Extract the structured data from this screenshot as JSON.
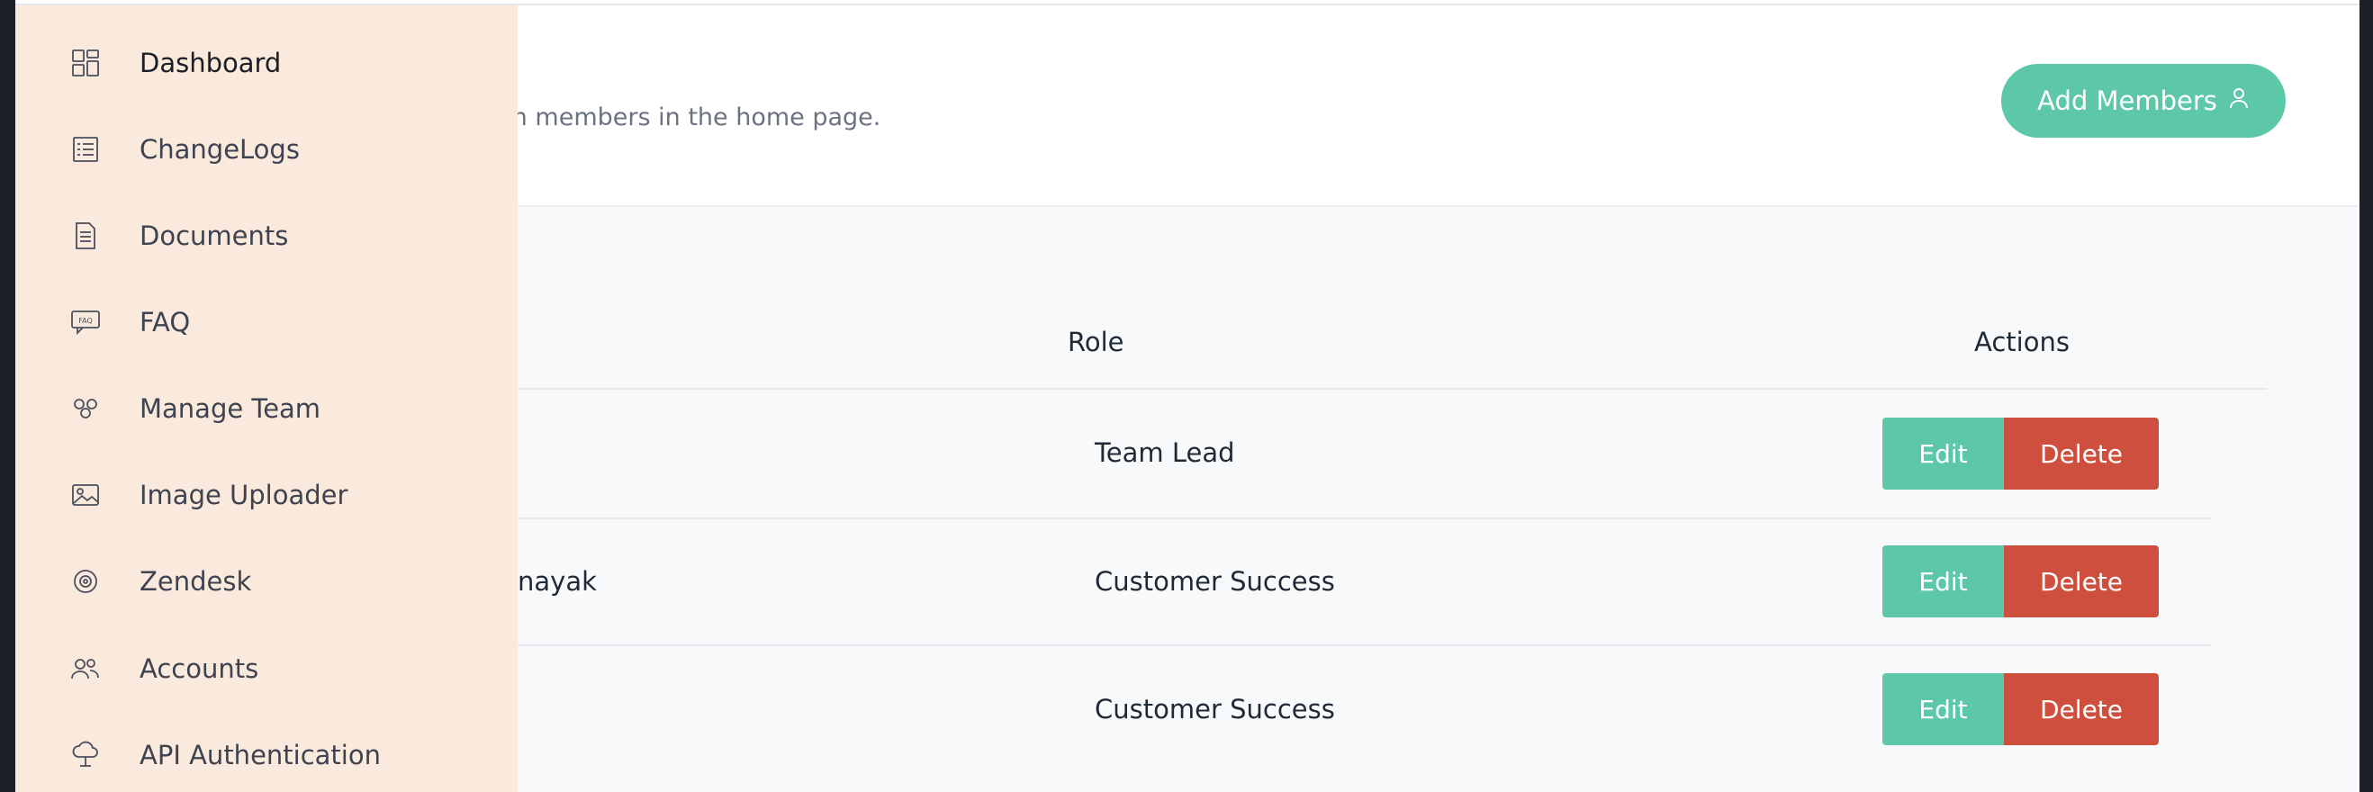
{
  "header": {
    "subtitle": "am members in the home page.",
    "add_button_label": "Add Members"
  },
  "table": {
    "columns": {
      "role": "Role",
      "actions": "Actions"
    },
    "rows": [
      {
        "name": "",
        "role": "Team Lead",
        "edit": "Edit",
        "delete": "Delete"
      },
      {
        "name": "nayak",
        "role": "Customer Success",
        "edit": "Edit",
        "delete": "Delete"
      },
      {
        "name": "",
        "role": "Customer Success",
        "edit": "Edit",
        "delete": "Delete"
      }
    ]
  },
  "sidebar": {
    "items": [
      {
        "label": "Dashboard",
        "icon": "dashboard-icon",
        "active": true
      },
      {
        "label": "ChangeLogs",
        "icon": "list-icon"
      },
      {
        "label": "Documents",
        "icon": "document-icon"
      },
      {
        "label": "FAQ",
        "icon": "faq-icon"
      },
      {
        "label": "Manage Team",
        "icon": "team-icon"
      },
      {
        "label": "Image Uploader",
        "icon": "image-icon"
      },
      {
        "label": "Zendesk",
        "icon": "zendesk-icon"
      },
      {
        "label": "Accounts",
        "icon": "users-icon"
      },
      {
        "label": "API Authentication",
        "icon": "cloud-key-icon"
      }
    ]
  },
  "colors": {
    "accent": "#5dc8a8",
    "danger": "#cf4f3e",
    "sidebar_bg": "#fae9dd",
    "main_bg": "#f8f9fb"
  }
}
